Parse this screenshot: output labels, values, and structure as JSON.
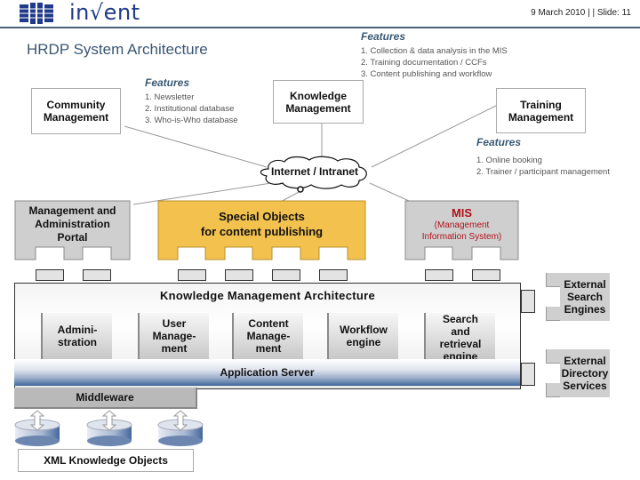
{
  "header": {
    "logo_text": "in√ent",
    "slide_meta": "9 March 2010 |  | Slide: 11",
    "title": "HRDP System Architecture"
  },
  "top_features": {
    "heading": "Features",
    "items": [
      "1.  Collection & data analysis in the MIS",
      "2.  Training documentation / CCFs",
      "3.  Content publishing and workflow"
    ]
  },
  "community": {
    "label_line1": "Community",
    "label_line2": "Management",
    "features_heading": "Features",
    "features": [
      "1.  Newsletter",
      "2.  Institutional database",
      "3.  Who-is-Who database"
    ]
  },
  "knowledge_mgmt": {
    "label_line1": "Knowledge",
    "label_line2": "Management"
  },
  "training": {
    "label_line1": "Training",
    "label_line2": "Management",
    "features_heading": "Features",
    "features": [
      "1.  Online booking",
      "2.  Trainer / participant management"
    ]
  },
  "network": {
    "label": "Internet / Intranet"
  },
  "portal": {
    "lines": [
      "Management and",
      "Administration",
      "Portal"
    ]
  },
  "special_objects": {
    "lines": [
      "Special Objects",
      "for content publishing"
    ]
  },
  "mis": {
    "title": "MIS",
    "sub_line1": "(Management",
    "sub_line2": "Information System)"
  },
  "km_architecture": {
    "title": "Knowledge Management Architecture",
    "modules": [
      {
        "l1": "Admini-",
        "l2": "stration",
        "l3": ""
      },
      {
        "l1": "User",
        "l2": "Manage-",
        "l3": "ment"
      },
      {
        "l1": "Content",
        "l2": "Manage-",
        "l3": "ment"
      },
      {
        "l1": "Workflow",
        "l2": "engine",
        "l3": ""
      },
      {
        "l1": "Search",
        "l2": "and",
        "l3": "retrieval",
        "l4": "engine"
      }
    ],
    "app_server": "Application Server",
    "middleware": "Middleware"
  },
  "xml_objects": "XML Knowledge Objects",
  "external": {
    "search": [
      "External",
      "Search",
      "Engines"
    ],
    "directory": [
      "External",
      "Directory",
      "Services"
    ]
  },
  "colors": {
    "title": "#3a5673",
    "special_objects": "#f2c14e",
    "grey_block": "#cfcfcf",
    "mis_red": "#b0121b",
    "app_server_blue": "#3f6699"
  }
}
